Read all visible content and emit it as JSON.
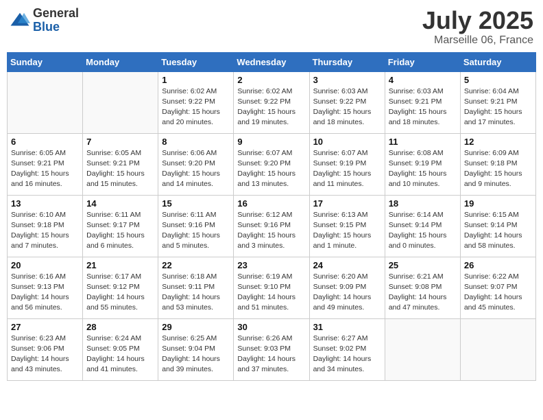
{
  "header": {
    "logo_general": "General",
    "logo_blue": "Blue",
    "month_title": "July 2025",
    "location": "Marseille 06, France"
  },
  "days_of_week": [
    "Sunday",
    "Monday",
    "Tuesday",
    "Wednesday",
    "Thursday",
    "Friday",
    "Saturday"
  ],
  "weeks": [
    [
      {
        "day": "",
        "info": ""
      },
      {
        "day": "",
        "info": ""
      },
      {
        "day": "1",
        "info": "Sunrise: 6:02 AM\nSunset: 9:22 PM\nDaylight: 15 hours\nand 20 minutes."
      },
      {
        "day": "2",
        "info": "Sunrise: 6:02 AM\nSunset: 9:22 PM\nDaylight: 15 hours\nand 19 minutes."
      },
      {
        "day": "3",
        "info": "Sunrise: 6:03 AM\nSunset: 9:22 PM\nDaylight: 15 hours\nand 18 minutes."
      },
      {
        "day": "4",
        "info": "Sunrise: 6:03 AM\nSunset: 9:21 PM\nDaylight: 15 hours\nand 18 minutes."
      },
      {
        "day": "5",
        "info": "Sunrise: 6:04 AM\nSunset: 9:21 PM\nDaylight: 15 hours\nand 17 minutes."
      }
    ],
    [
      {
        "day": "6",
        "info": "Sunrise: 6:05 AM\nSunset: 9:21 PM\nDaylight: 15 hours\nand 16 minutes."
      },
      {
        "day": "7",
        "info": "Sunrise: 6:05 AM\nSunset: 9:21 PM\nDaylight: 15 hours\nand 15 minutes."
      },
      {
        "day": "8",
        "info": "Sunrise: 6:06 AM\nSunset: 9:20 PM\nDaylight: 15 hours\nand 14 minutes."
      },
      {
        "day": "9",
        "info": "Sunrise: 6:07 AM\nSunset: 9:20 PM\nDaylight: 15 hours\nand 13 minutes."
      },
      {
        "day": "10",
        "info": "Sunrise: 6:07 AM\nSunset: 9:19 PM\nDaylight: 15 hours\nand 11 minutes."
      },
      {
        "day": "11",
        "info": "Sunrise: 6:08 AM\nSunset: 9:19 PM\nDaylight: 15 hours\nand 10 minutes."
      },
      {
        "day": "12",
        "info": "Sunrise: 6:09 AM\nSunset: 9:18 PM\nDaylight: 15 hours\nand 9 minutes."
      }
    ],
    [
      {
        "day": "13",
        "info": "Sunrise: 6:10 AM\nSunset: 9:18 PM\nDaylight: 15 hours\nand 7 minutes."
      },
      {
        "day": "14",
        "info": "Sunrise: 6:11 AM\nSunset: 9:17 PM\nDaylight: 15 hours\nand 6 minutes."
      },
      {
        "day": "15",
        "info": "Sunrise: 6:11 AM\nSunset: 9:16 PM\nDaylight: 15 hours\nand 5 minutes."
      },
      {
        "day": "16",
        "info": "Sunrise: 6:12 AM\nSunset: 9:16 PM\nDaylight: 15 hours\nand 3 minutes."
      },
      {
        "day": "17",
        "info": "Sunrise: 6:13 AM\nSunset: 9:15 PM\nDaylight: 15 hours\nand 1 minute."
      },
      {
        "day": "18",
        "info": "Sunrise: 6:14 AM\nSunset: 9:14 PM\nDaylight: 15 hours\nand 0 minutes."
      },
      {
        "day": "19",
        "info": "Sunrise: 6:15 AM\nSunset: 9:14 PM\nDaylight: 14 hours\nand 58 minutes."
      }
    ],
    [
      {
        "day": "20",
        "info": "Sunrise: 6:16 AM\nSunset: 9:13 PM\nDaylight: 14 hours\nand 56 minutes."
      },
      {
        "day": "21",
        "info": "Sunrise: 6:17 AM\nSunset: 9:12 PM\nDaylight: 14 hours\nand 55 minutes."
      },
      {
        "day": "22",
        "info": "Sunrise: 6:18 AM\nSunset: 9:11 PM\nDaylight: 14 hours\nand 53 minutes."
      },
      {
        "day": "23",
        "info": "Sunrise: 6:19 AM\nSunset: 9:10 PM\nDaylight: 14 hours\nand 51 minutes."
      },
      {
        "day": "24",
        "info": "Sunrise: 6:20 AM\nSunset: 9:09 PM\nDaylight: 14 hours\nand 49 minutes."
      },
      {
        "day": "25",
        "info": "Sunrise: 6:21 AM\nSunset: 9:08 PM\nDaylight: 14 hours\nand 47 minutes."
      },
      {
        "day": "26",
        "info": "Sunrise: 6:22 AM\nSunset: 9:07 PM\nDaylight: 14 hours\nand 45 minutes."
      }
    ],
    [
      {
        "day": "27",
        "info": "Sunrise: 6:23 AM\nSunset: 9:06 PM\nDaylight: 14 hours\nand 43 minutes."
      },
      {
        "day": "28",
        "info": "Sunrise: 6:24 AM\nSunset: 9:05 PM\nDaylight: 14 hours\nand 41 minutes."
      },
      {
        "day": "29",
        "info": "Sunrise: 6:25 AM\nSunset: 9:04 PM\nDaylight: 14 hours\nand 39 minutes."
      },
      {
        "day": "30",
        "info": "Sunrise: 6:26 AM\nSunset: 9:03 PM\nDaylight: 14 hours\nand 37 minutes."
      },
      {
        "day": "31",
        "info": "Sunrise: 6:27 AM\nSunset: 9:02 PM\nDaylight: 14 hours\nand 34 minutes."
      },
      {
        "day": "",
        "info": ""
      },
      {
        "day": "",
        "info": ""
      }
    ]
  ]
}
